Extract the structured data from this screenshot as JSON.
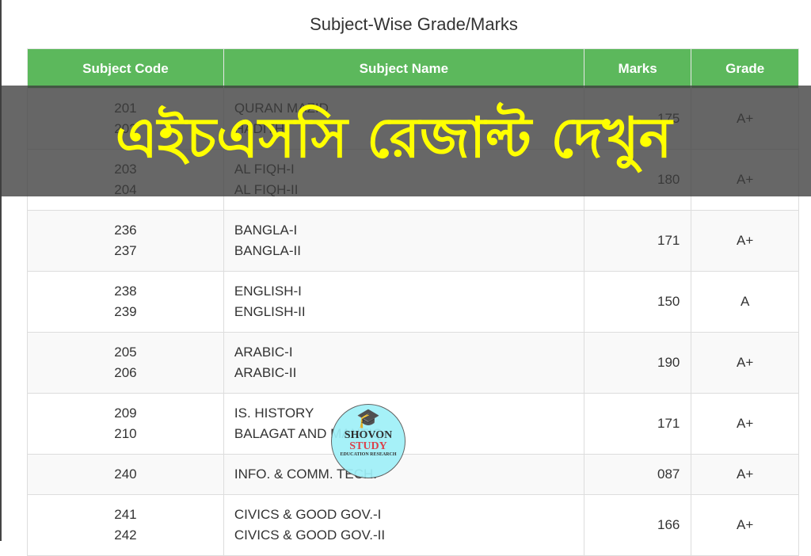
{
  "title": "Subject-Wise Grade/Marks",
  "headers": [
    "Subject Code",
    "Subject Name",
    "Marks",
    "Grade"
  ],
  "rows": [
    {
      "codes": [
        "201",
        "202"
      ],
      "names": [
        "QURAN MAZID",
        "HADITH"
      ],
      "marks": "175",
      "grade": "A+"
    },
    {
      "codes": [
        "203",
        "204"
      ],
      "names": [
        "AL FIQH-I",
        "AL FIQH-II"
      ],
      "marks": "180",
      "grade": "A+"
    },
    {
      "codes": [
        "236",
        "237"
      ],
      "names": [
        "BANGLA-I",
        "BANGLA-II"
      ],
      "marks": "171",
      "grade": "A+"
    },
    {
      "codes": [
        "238",
        "239"
      ],
      "names": [
        "ENGLISH-I",
        "ENGLISH-II"
      ],
      "marks": "150",
      "grade": "A"
    },
    {
      "codes": [
        "205",
        "206"
      ],
      "names": [
        "ARABIC-I",
        "ARABIC-II"
      ],
      "marks": "190",
      "grade": "A+"
    },
    {
      "codes": [
        "209",
        "210"
      ],
      "names": [
        "IS. HISTORY",
        "BALAGAT AND MANTIQ"
      ],
      "marks": "171",
      "grade": "A+"
    },
    {
      "codes": [
        "240"
      ],
      "names": [
        "INFO. & COMM. TECH."
      ],
      "marks": "087",
      "grade": "A+"
    },
    {
      "codes": [
        "241",
        "242"
      ],
      "names": [
        "CIVICS & GOOD GOV.-I",
        "CIVICS & GOOD GOV.-II"
      ],
      "marks": "166",
      "grade": "A+"
    }
  ],
  "overlay_text": "এইচএসসি রেজাল্ট দেখুন",
  "logo": {
    "line1": "SHOVON",
    "line2": "STUDY",
    "line3": "EDUCATION RESEARCH",
    "icon": "graduation-cap-icon"
  },
  "colors": {
    "header_bg": "#5cb85c",
    "overlay_text": "#ffff00"
  }
}
